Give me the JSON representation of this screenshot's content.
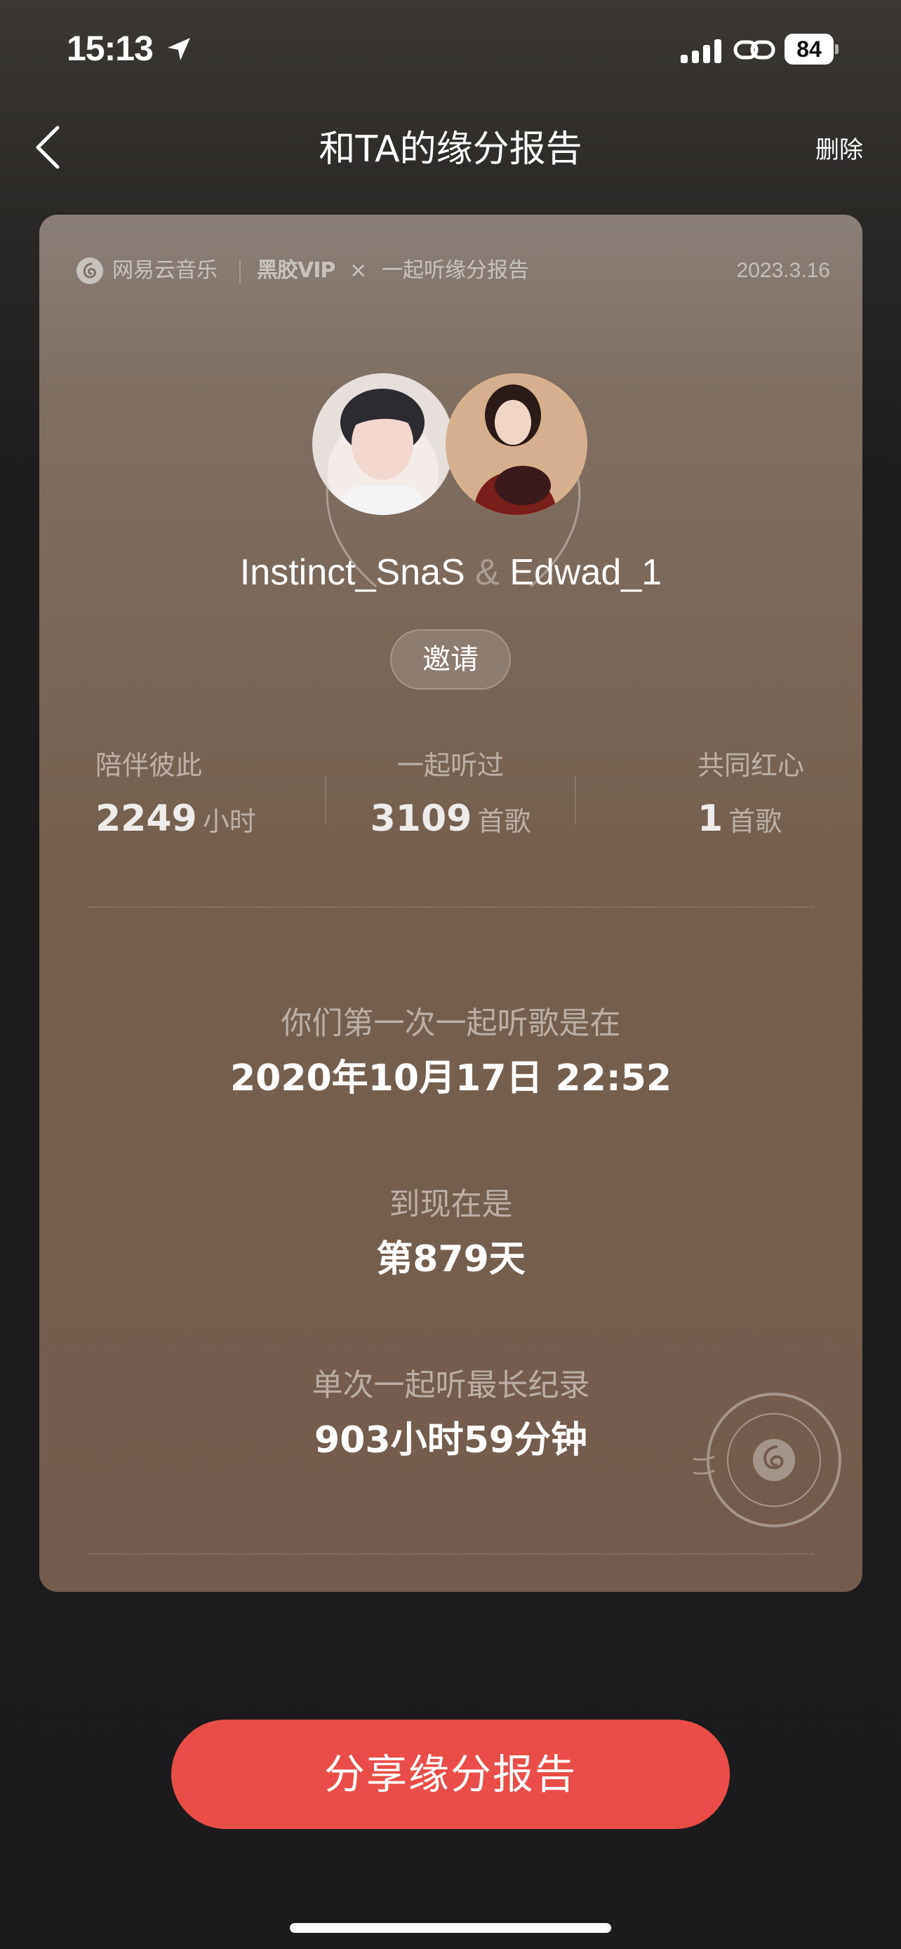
{
  "status_bar": {
    "time": "15:13",
    "battery": "84"
  },
  "nav": {
    "title": "和TA的缘分报告",
    "delete_label": "删除"
  },
  "card": {
    "brand": "网易云音乐",
    "vip": "黑胶VIP",
    "cross": "×",
    "report_label": "一起听缘分报告",
    "date": "2023.3.16",
    "user1": "Instinct_SnaS",
    "amp": "&",
    "user2": "Edwad_1",
    "invite_label": "邀请",
    "stats": [
      {
        "label": "陪伴彼此",
        "value": "2249",
        "unit": "小时"
      },
      {
        "label": "一起听过",
        "value": "3109",
        "unit": "首歌"
      },
      {
        "label": "共同红心",
        "value": "1",
        "unit": "首歌"
      }
    ],
    "first_listen_label": "你们第一次一起听歌是在",
    "first_listen_value": "2020年10月17日  22:52",
    "until_now_label": "到现在是",
    "until_now_value": "第879天",
    "longest_label": "单次一起听最长纪录",
    "longest_value": "903小时59分钟"
  },
  "share_button_label": "分享缘分报告"
}
